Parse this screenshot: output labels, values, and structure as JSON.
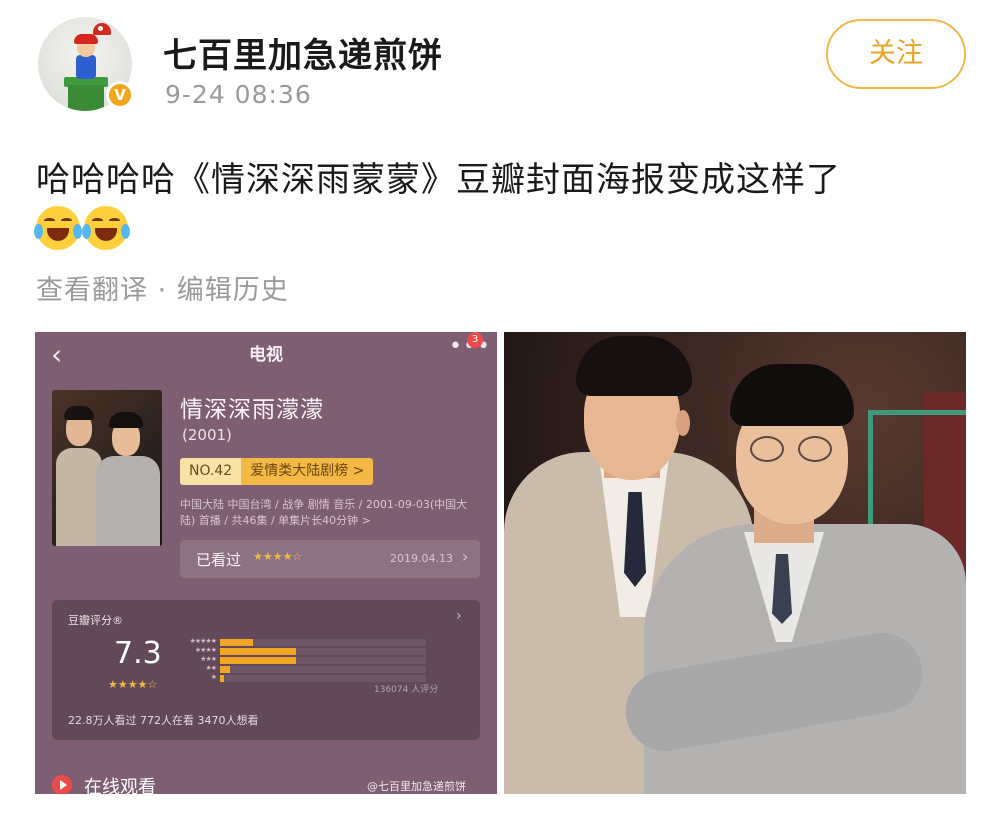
{
  "post": {
    "username": "七百里加急递煎饼",
    "time": "9-24 08:36",
    "follow_label": "关注",
    "text": "哈哈哈哈《情深深雨蒙蒙》豆瓣封面海报变成这样了",
    "meta": "查看翻译 · 编辑历史"
  },
  "douban": {
    "back_icon": "‹",
    "title": "电视",
    "more_icon": "•••",
    "badge_count": "3",
    "show_name": "情深深雨濛濛",
    "year": "(2001)",
    "rank_no": "NO.42",
    "rank_list": "爱情类大陆剧榜 >",
    "info": "中国大陆 中国台湾 / 战争 剧情 音乐 / 2001-09-03(中国大陆) 首播 / 共46集 / 单集片长40分钟 >",
    "watched_label": "已看过",
    "watched_stars": "★★★★☆",
    "watched_date": "2019.04.13",
    "rating_label": "豆瓣评分®",
    "score": "7.3",
    "score_stars": "★★★★☆",
    "rating_count": "136074 人评分",
    "stats": "22.8万人看过   772人在看   3470人想看",
    "online_label": "在线观看",
    "watermark": "@七百里加急递煎饼"
  },
  "chart_data": {
    "type": "bar",
    "categories": [
      "5 stars",
      "4 stars",
      "3 stars",
      "2 stars",
      "1 star"
    ],
    "values": [
      0.16,
      0.37,
      0.37,
      0.05,
      0.02
    ],
    "title": "",
    "xlabel": "",
    "ylabel": ""
  }
}
